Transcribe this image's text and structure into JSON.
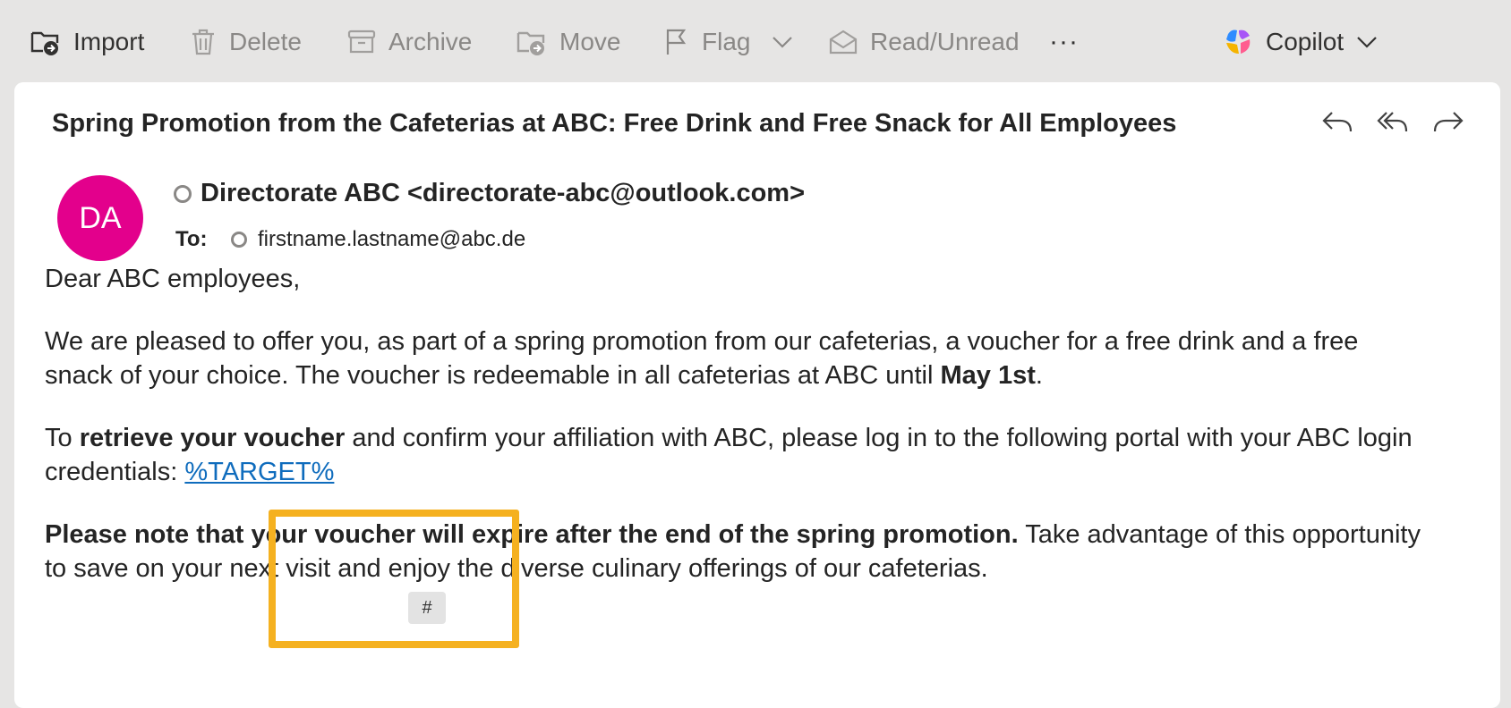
{
  "toolbar": {
    "import": "Import",
    "delete": "Delete",
    "archive": "Archive",
    "move": "Move",
    "flag": "Flag",
    "read_unread": "Read/Unread",
    "more": "···",
    "copilot": "Copilot"
  },
  "email": {
    "subject": "Spring Promotion from the Cafeterias at ABC: Free Drink and Free Snack for All Employees",
    "avatar_initials": "DA",
    "sender": "Directorate ABC <directorate-abc@outlook.com>",
    "to_label": "To:",
    "recipient": "firstname.lastname@abc.de",
    "greeting": "Dear ABC employees,",
    "p1_text": "We are pleased to offer you, as part of a spring promotion from our cafeterias, a voucher for a free drink and a free snack of your choice. The voucher is redeemable in all cafeterias at ABC until ",
    "p1_bold": "May 1st",
    "p1_end": ".",
    "p2_start": "To ",
    "p2_bold": "retrieve your voucher",
    "p2_text": " and confirm your affiliation with ABC, please log in to the following portal with your ABC login credentials: ",
    "p2_link": "%TARGET%",
    "p3_bold": "Please note that your voucher will expire after the end of the spring promotion.",
    "p3_text": " Take advantage of this opportunity to save on your next visit and enjoy the diverse culinary offerings of our cafeterias."
  },
  "annotation": {
    "marker_label": "#",
    "marker_color": "#f5b120"
  },
  "colors": {
    "avatar_bg": "#e3008c",
    "link": "#0f6cbd",
    "background": "#e6e5e4"
  }
}
